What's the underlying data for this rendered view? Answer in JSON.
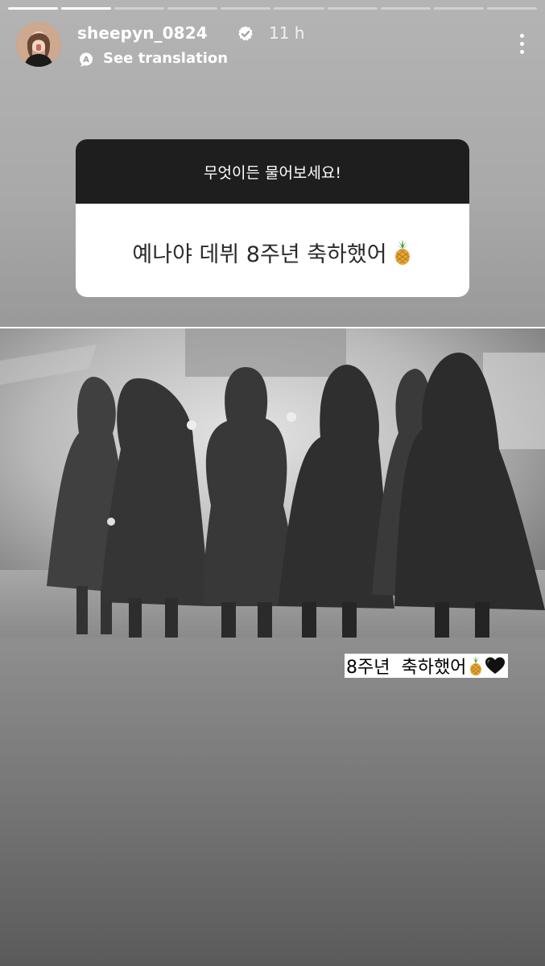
{
  "story": {
    "segments": [
      1,
      1,
      0,
      0,
      0,
      0,
      0,
      0,
      0,
      0
    ]
  },
  "header": {
    "username": "sheepyn_0824",
    "verified_icon": "verified-badge-icon",
    "time": "11 h",
    "translate_label": "See translation",
    "more_icon": "more-vertical-icon"
  },
  "question_sticker": {
    "prompt": "무엇이든 물어보세요!",
    "answer": "예나야 데뷔 8주년 축하했어"
  },
  "caption": {
    "text": "8주년  축하했어"
  },
  "icons": {
    "pineapple": "pineapple-icon",
    "heart": "black-heart-icon"
  },
  "colors": {
    "sticker_header": "#1e1e1e",
    "text_white": "#ffffff"
  }
}
